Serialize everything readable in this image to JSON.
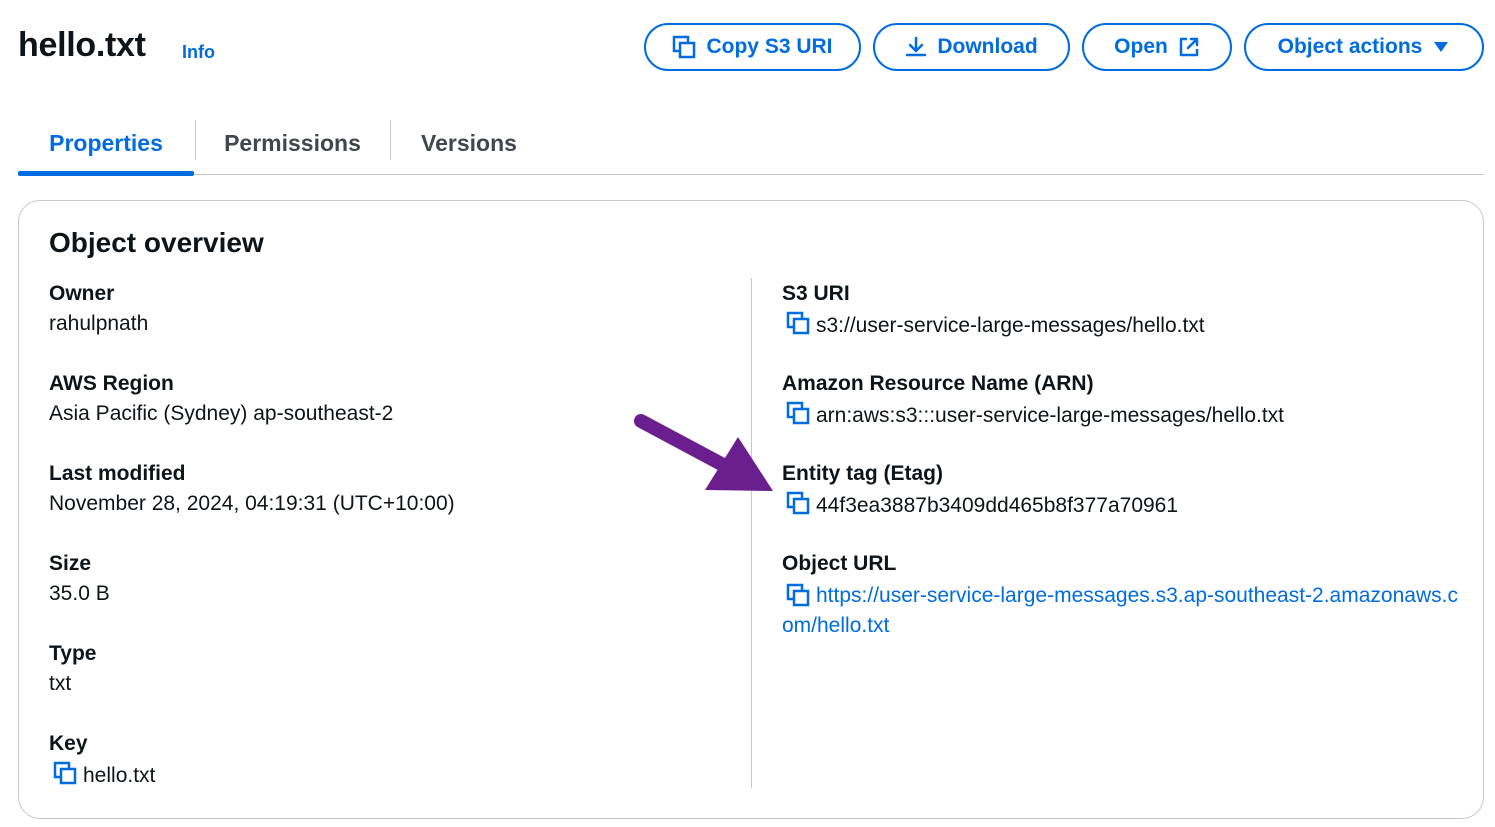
{
  "header": {
    "title": "hello.txt",
    "info_link": "Info",
    "buttons": {
      "copy_s3_uri": "Copy S3 URI",
      "download": "Download",
      "open": "Open",
      "object_actions": "Object actions"
    }
  },
  "tabs": [
    {
      "label": "Properties",
      "active": true
    },
    {
      "label": "Permissions",
      "active": false
    },
    {
      "label": "Versions",
      "active": false
    }
  ],
  "overview": {
    "title": "Object overview",
    "left": {
      "owner": {
        "label": "Owner",
        "value": "rahulpnath"
      },
      "region": {
        "label": "AWS Region",
        "value": "Asia Pacific (Sydney) ap-southeast-2"
      },
      "last_modified": {
        "label": "Last modified",
        "value": "November 28, 2024, 04:19:31 (UTC+10:00)"
      },
      "size": {
        "label": "Size",
        "value": "35.0 B"
      },
      "type": {
        "label": "Type",
        "value": "txt"
      },
      "key": {
        "label": "Key",
        "value": "hello.txt"
      }
    },
    "right": {
      "s3_uri": {
        "label": "S3 URI",
        "value": "s3://user-service-large-messages/hello.txt"
      },
      "arn": {
        "label": "Amazon Resource Name (ARN)",
        "value": "arn:aws:s3:::user-service-large-messages/hello.txt"
      },
      "etag": {
        "label": "Entity tag (Etag)",
        "value": "44f3ea3887b3409dd465b8f377a70961"
      },
      "object_url": {
        "label": "Object URL",
        "value": "https://user-service-large-messages.s3.ap-southeast-2.amazonaws.com/hello.txt"
      }
    }
  },
  "colors": {
    "accent": "#006ce0",
    "text": "#0f141a",
    "muted": "#424650",
    "border": "#c6c6cd",
    "annotation_arrow": "#6b1f8f"
  },
  "icons": {
    "copy": "copy-icon",
    "download": "download-icon",
    "external": "external-link-icon",
    "caret": "caret-down-icon"
  }
}
